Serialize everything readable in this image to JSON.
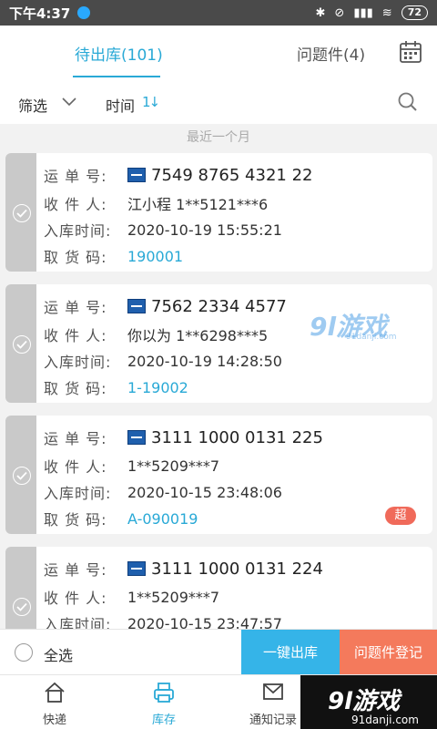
{
  "status_bar": {
    "time": "下午4:37",
    "battery": "72"
  },
  "top_tabs": {
    "pending": "待出库(101)",
    "problem": "问题件(4)"
  },
  "filter": {
    "filter_label": "筛选",
    "sort_label": "时间",
    "sort_icon": "1↓"
  },
  "section_header": "最近一个月",
  "labels": {
    "waybill": "运 单 号:",
    "recipient": "收 件 人:",
    "inbound_time": "入库时间:",
    "pickup_code": "取 货 码:"
  },
  "packages": [
    {
      "tracking": "7549 8765 4321 22",
      "recipient": "江小程 1**5121***6",
      "inbound_time": "2020-10-19 15:55:21",
      "pickup_code": "190001"
    },
    {
      "tracking": "7562 2334 4577",
      "recipient": "你以为 1**6298***5",
      "inbound_time": "2020-10-19 14:28:50",
      "pickup_code": "1-19002"
    },
    {
      "tracking": "3111 1000 0131 225",
      "recipient": " 1**5209***7",
      "inbound_time": "2020-10-15 23:48:06",
      "pickup_code": "A-090019",
      "badge": "超"
    },
    {
      "tracking": "3111 1000 0131 224",
      "recipient": " 1**5209***7",
      "inbound_time": "2020-10-15 23:47:57"
    }
  ],
  "watermark": {
    "main": "9l游戏",
    "sub": "91danji.com"
  },
  "action_bar": {
    "select_all": "全选",
    "checkout": "一键出库",
    "problem_register": "问题件登记"
  },
  "bottom_nav": {
    "express": "快递",
    "inventory": "库存",
    "notify": "通知记录",
    "watermark_main": "9l游戏",
    "watermark_sub": "91danji.com"
  },
  "colors": {
    "accent": "#29a9d6",
    "checkout_button": "#35b4e8",
    "problem_button": "#f47a5c",
    "badge": "#f06a5a"
  }
}
